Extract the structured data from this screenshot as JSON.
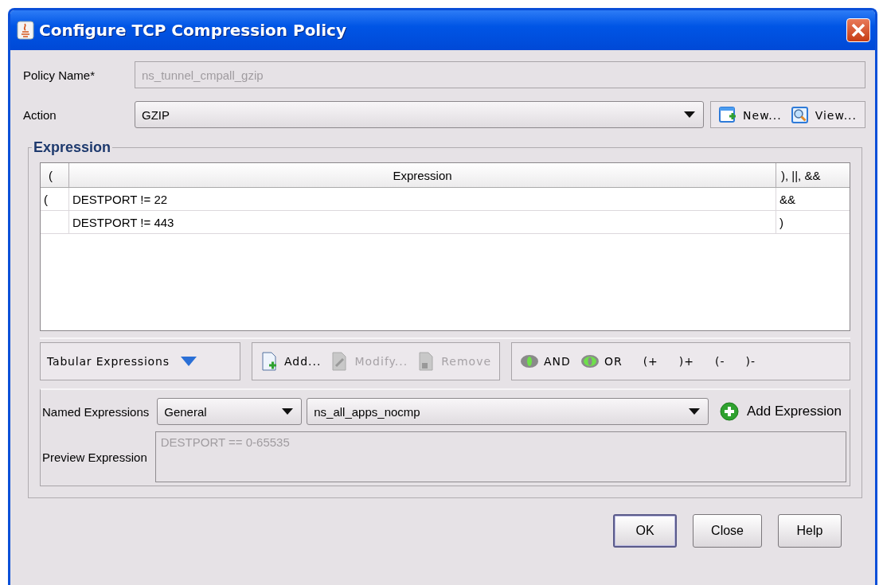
{
  "window": {
    "title": "Configure TCP Compression Policy"
  },
  "policy_name": {
    "label": "Policy Name*",
    "value": "ns_tunnel_cmpall_gzip",
    "disabled": true
  },
  "action": {
    "label": "Action",
    "value": "GZIP",
    "buttons": [
      {
        "label": "New...",
        "kind": "new"
      },
      {
        "label": "View...",
        "kind": "view"
      }
    ]
  },
  "expression": {
    "title": "Expression",
    "table": {
      "columns": [
        "(",
        "Expression",
        "), ||, &&"
      ],
      "rows": [
        {
          "open": "(",
          "expression": "DESTPORT != 22",
          "close": "&&"
        },
        {
          "expression": "DESTPORT != 443",
          "close": ")"
        }
      ]
    },
    "toolbar": {
      "menu": "Tabular Expressions",
      "edit_buttons": [
        {
          "label": "Add...",
          "kind": "add",
          "disabled": false
        },
        {
          "label": "Modify...",
          "kind": "modify",
          "disabled": true
        },
        {
          "label": "Remove",
          "kind": "remove",
          "disabled": true
        }
      ],
      "operators": [
        {
          "label": "AND",
          "kind": "and"
        },
        {
          "label": "OR",
          "kind": "or"
        },
        {
          "label": "(+",
          "kind": "text"
        },
        {
          "label": ")+",
          "kind": "text"
        },
        {
          "label": "(-",
          "kind": "text"
        },
        {
          "label": ")-",
          "kind": "text"
        }
      ]
    },
    "named": {
      "label": "Named Expressions",
      "category": "General",
      "expression": "ns_all_apps_nocmp",
      "add_button": "Add Expression",
      "preview_label": "Preview Expression",
      "preview": "DESTPORT == 0-65535"
    }
  },
  "buttons": [
    {
      "label": "OK",
      "default": true
    },
    {
      "label": "Close",
      "default": false
    },
    {
      "label": "Help",
      "default": false
    }
  ]
}
